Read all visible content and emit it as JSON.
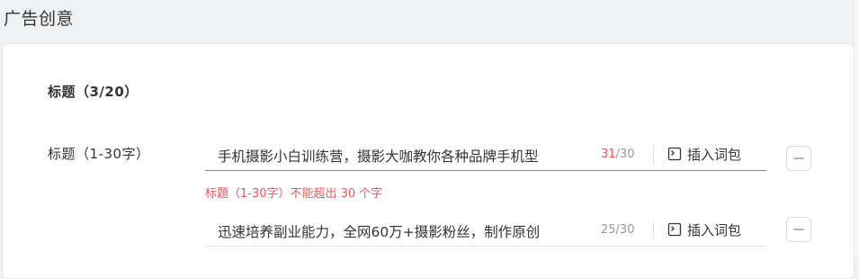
{
  "section": {
    "title": "广告创意"
  },
  "title_group": {
    "heading": "标题（3/20）",
    "field_label": "标题（1-30字）",
    "rows": [
      {
        "value": "手机摄影小白训练营，摄影大咖教你各种品牌手机型",
        "count": "31",
        "max": "/30",
        "over_limit": true,
        "insert_label": "插入词包"
      },
      {
        "value": "迅速培养副业能力，全网60万+摄影粉丝，制作原创",
        "count": "25",
        "max": "/30",
        "over_limit": false,
        "insert_label": "插入词包"
      }
    ],
    "error_message": "标题（1-30字）不能超出 30 个字"
  },
  "colors": {
    "error": "#f0535a",
    "text": "#333333",
    "muted": "#999999"
  },
  "icons": {
    "insert": "wordpack-icon",
    "remove": "minus-icon"
  }
}
